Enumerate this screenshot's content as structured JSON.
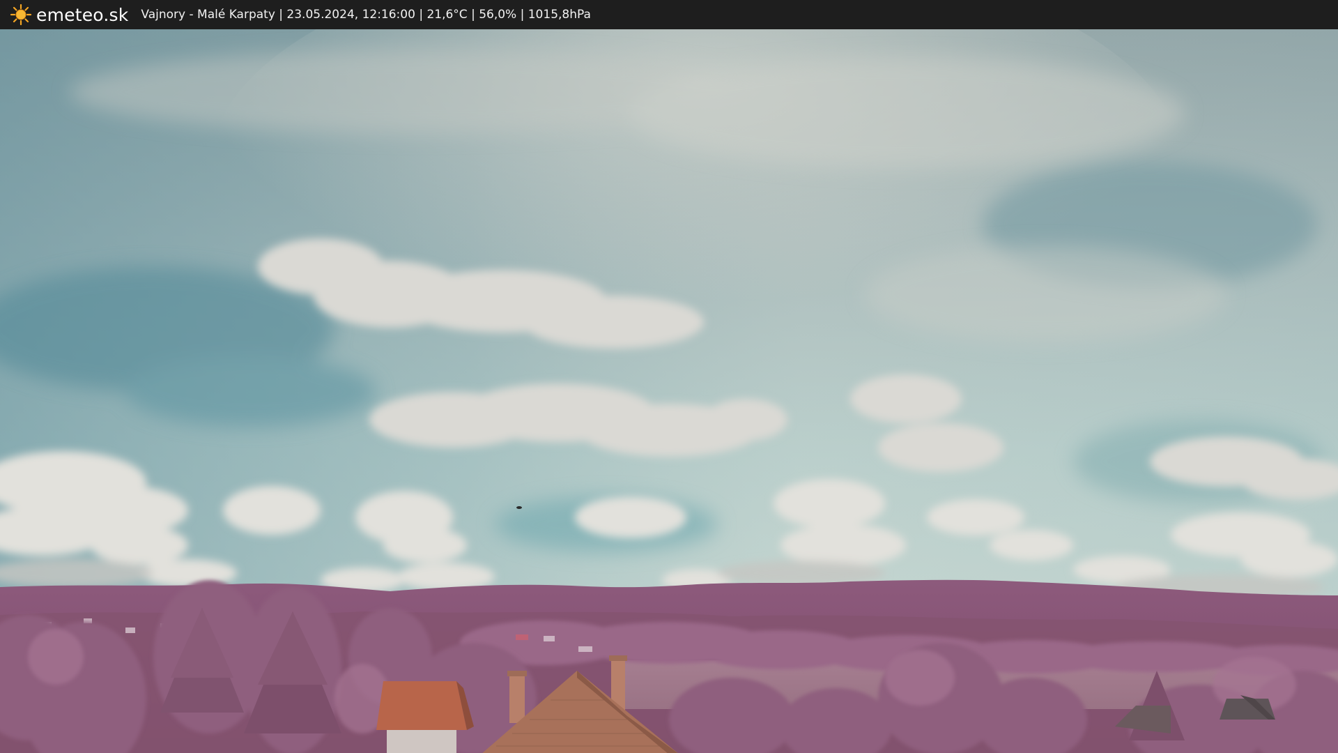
{
  "header": {
    "logo_text": "emeteo.sk",
    "logo_icon": "sun-icon",
    "caption": "Vajnory - Malé Karpaty | 23.05.2024, 12:16:00 | 21,6°C | 56,0% | 1015,8hPa"
  },
  "colors": {
    "topbar": "#1e1e1e",
    "logo_sun": "#f5a623",
    "sky_top": "#8ea3a8",
    "sky_bottom": "#b9d2cf",
    "hills": "#8a5778",
    "trees": "#9b6a88",
    "roof": "#b96a4a"
  }
}
